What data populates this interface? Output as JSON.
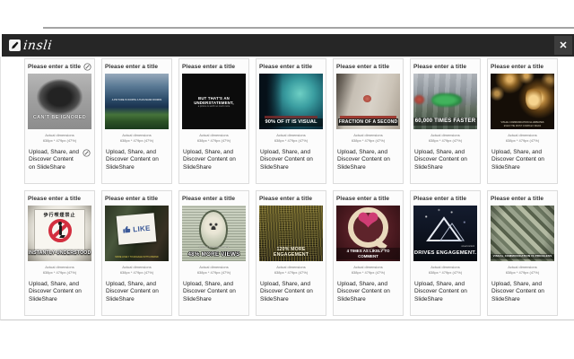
{
  "header": {
    "logo_text": "insli"
  },
  "icons": {
    "close": "✕",
    "heart": "❤"
  },
  "shared": {
    "title_placeholder": "Please enter a title",
    "dims_label": "Actual dimensions",
    "dims_value": "638px * 479px (47%)",
    "description": "Upload, Share, and Discover Content on SlideShare"
  },
  "cards": [
    {
      "thumb": "hands-camera",
      "caption": "CAN'T BE IGNORED"
    },
    {
      "thumb": "storm-landscape",
      "caption": "A PICTURE IS WORTH A THOUSAND WORDS"
    },
    {
      "thumb": "black-slide",
      "caption": "BUT THAT'S AN UNDERSTATEMENT,",
      "caption_sub": "a picture is worth so much more"
    },
    {
      "thumb": "xray-head",
      "caption": "90% OF IT IS VISUAL"
    },
    {
      "thumb": "finger-snap",
      "caption": "FRACTION OF A SECOND"
    },
    {
      "thumb": "race-car",
      "caption": "60,000 TIMES FASTER"
    },
    {
      "thumb": "light-bulbs",
      "caption": "VISUAL COMMUNICATION ILLUMINATES",
      "caption_sub": "EVEN THE MOST COMPLEX IDEAS"
    },
    {
      "thumb": "no-smoking-sign",
      "caption": "INSTANTLY UNDERSTOOD",
      "sign_text": "歩行喫煙禁止"
    },
    {
      "thumb": "facebook-like",
      "caption": "MORE LIKELY TO ENGAGE WITH A BRAND",
      "like_label": "LIKE"
    },
    {
      "thumb": "dollar-bill",
      "caption": "48% MORE VIEWS",
      "caption_sub": "CONTENT WITH VISUALS GETS"
    },
    {
      "thumb": "crowd",
      "caption": "120% MORE ENGAGEMENT",
      "caption_sub": "POSTS WITH PHOTOS GET"
    },
    {
      "thumb": "heart-q",
      "caption": "4 TIMES AS LIKELY TO COMMENT",
      "caption_sub": "PEOPLE ARE"
    },
    {
      "thumb": "night-mountain",
      "caption": "DRIVES ENGAGEMENT.",
      "caption_sub": "visual content"
    },
    {
      "thumb": "money-collage",
      "caption": "VISUAL COMMUNICATION IS PRICELESS"
    }
  ],
  "colors": {
    "header_bg": "#262626",
    "prohibition_red": "#d32f3f",
    "facebook_blue": "#3b5998"
  }
}
